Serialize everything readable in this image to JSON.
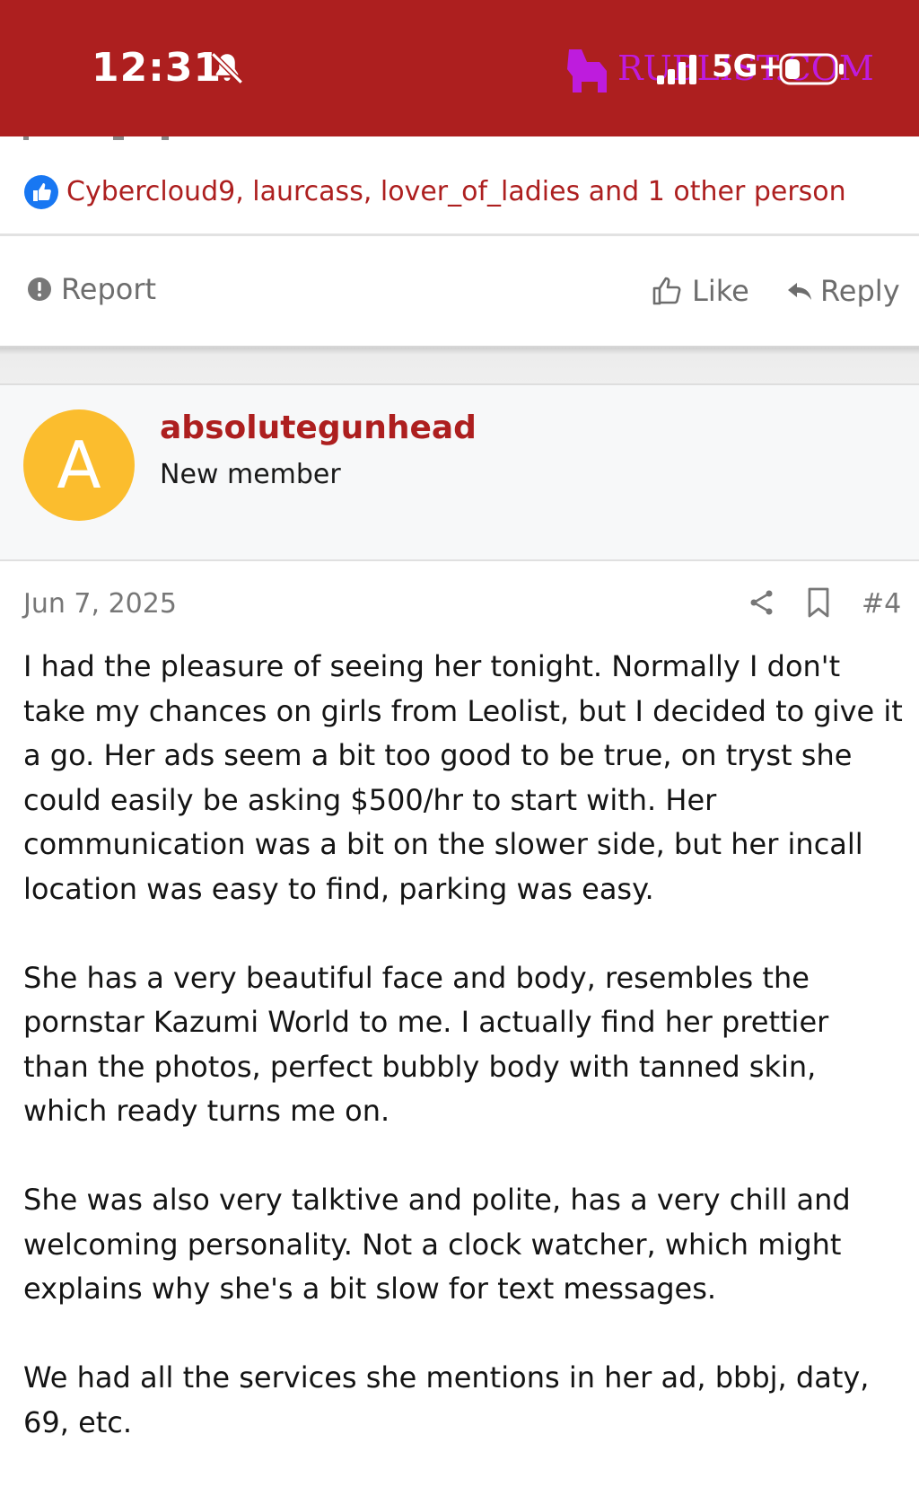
{
  "status_bar": {
    "time": "12:31",
    "network": "5G+",
    "watermark": "RUBLIST.COM"
  },
  "reactions": {
    "text": "Cybercloud9, laurcass, lover_of_ladies and 1 other person"
  },
  "actions": {
    "report_label": "Report",
    "like_label": "Like",
    "reply_label": "Reply"
  },
  "post": {
    "author": {
      "avatar_letter": "A",
      "username": "absolutegunhead",
      "title": "New member"
    },
    "date": "Jun 7, 2025",
    "number": "#4",
    "paragraphs": [
      "I had the pleasure of seeing her tonight. Normally I don't take my chances on girls from Leolist, but I decided to give it a go. Her ads seem a bit too good to be true, on tryst she could easily be asking $500/hr to start with. Her communication was a bit on the slower side, but her incall location was easy to find, parking was easy.",
      "She has a very beautiful face and body, resembles the pornstar Kazumi World to me. I actually find her prettier than the photos, perfect bubbly body with tanned skin, which ready turns me on.",
      "She was also very talktive and polite, has a very chill and welcoming personality. Not a clock watcher, which might explains why she's a bit slow for text messages.",
      "We had all the services she mentions in her ad, bbbj, daty, 69, etc."
    ]
  },
  "colors": {
    "brand_red": "#ad1f1f",
    "avatar_yellow": "#fbbd2e",
    "like_blue": "#1877f2",
    "muted_gray": "#6d6d6d"
  },
  "icons": [
    "bell-off-icon",
    "signal-icon",
    "battery-icon",
    "like-badge-icon",
    "report-icon",
    "thumbs-up-icon",
    "reply-icon",
    "share-icon",
    "bookmark-icon"
  ]
}
